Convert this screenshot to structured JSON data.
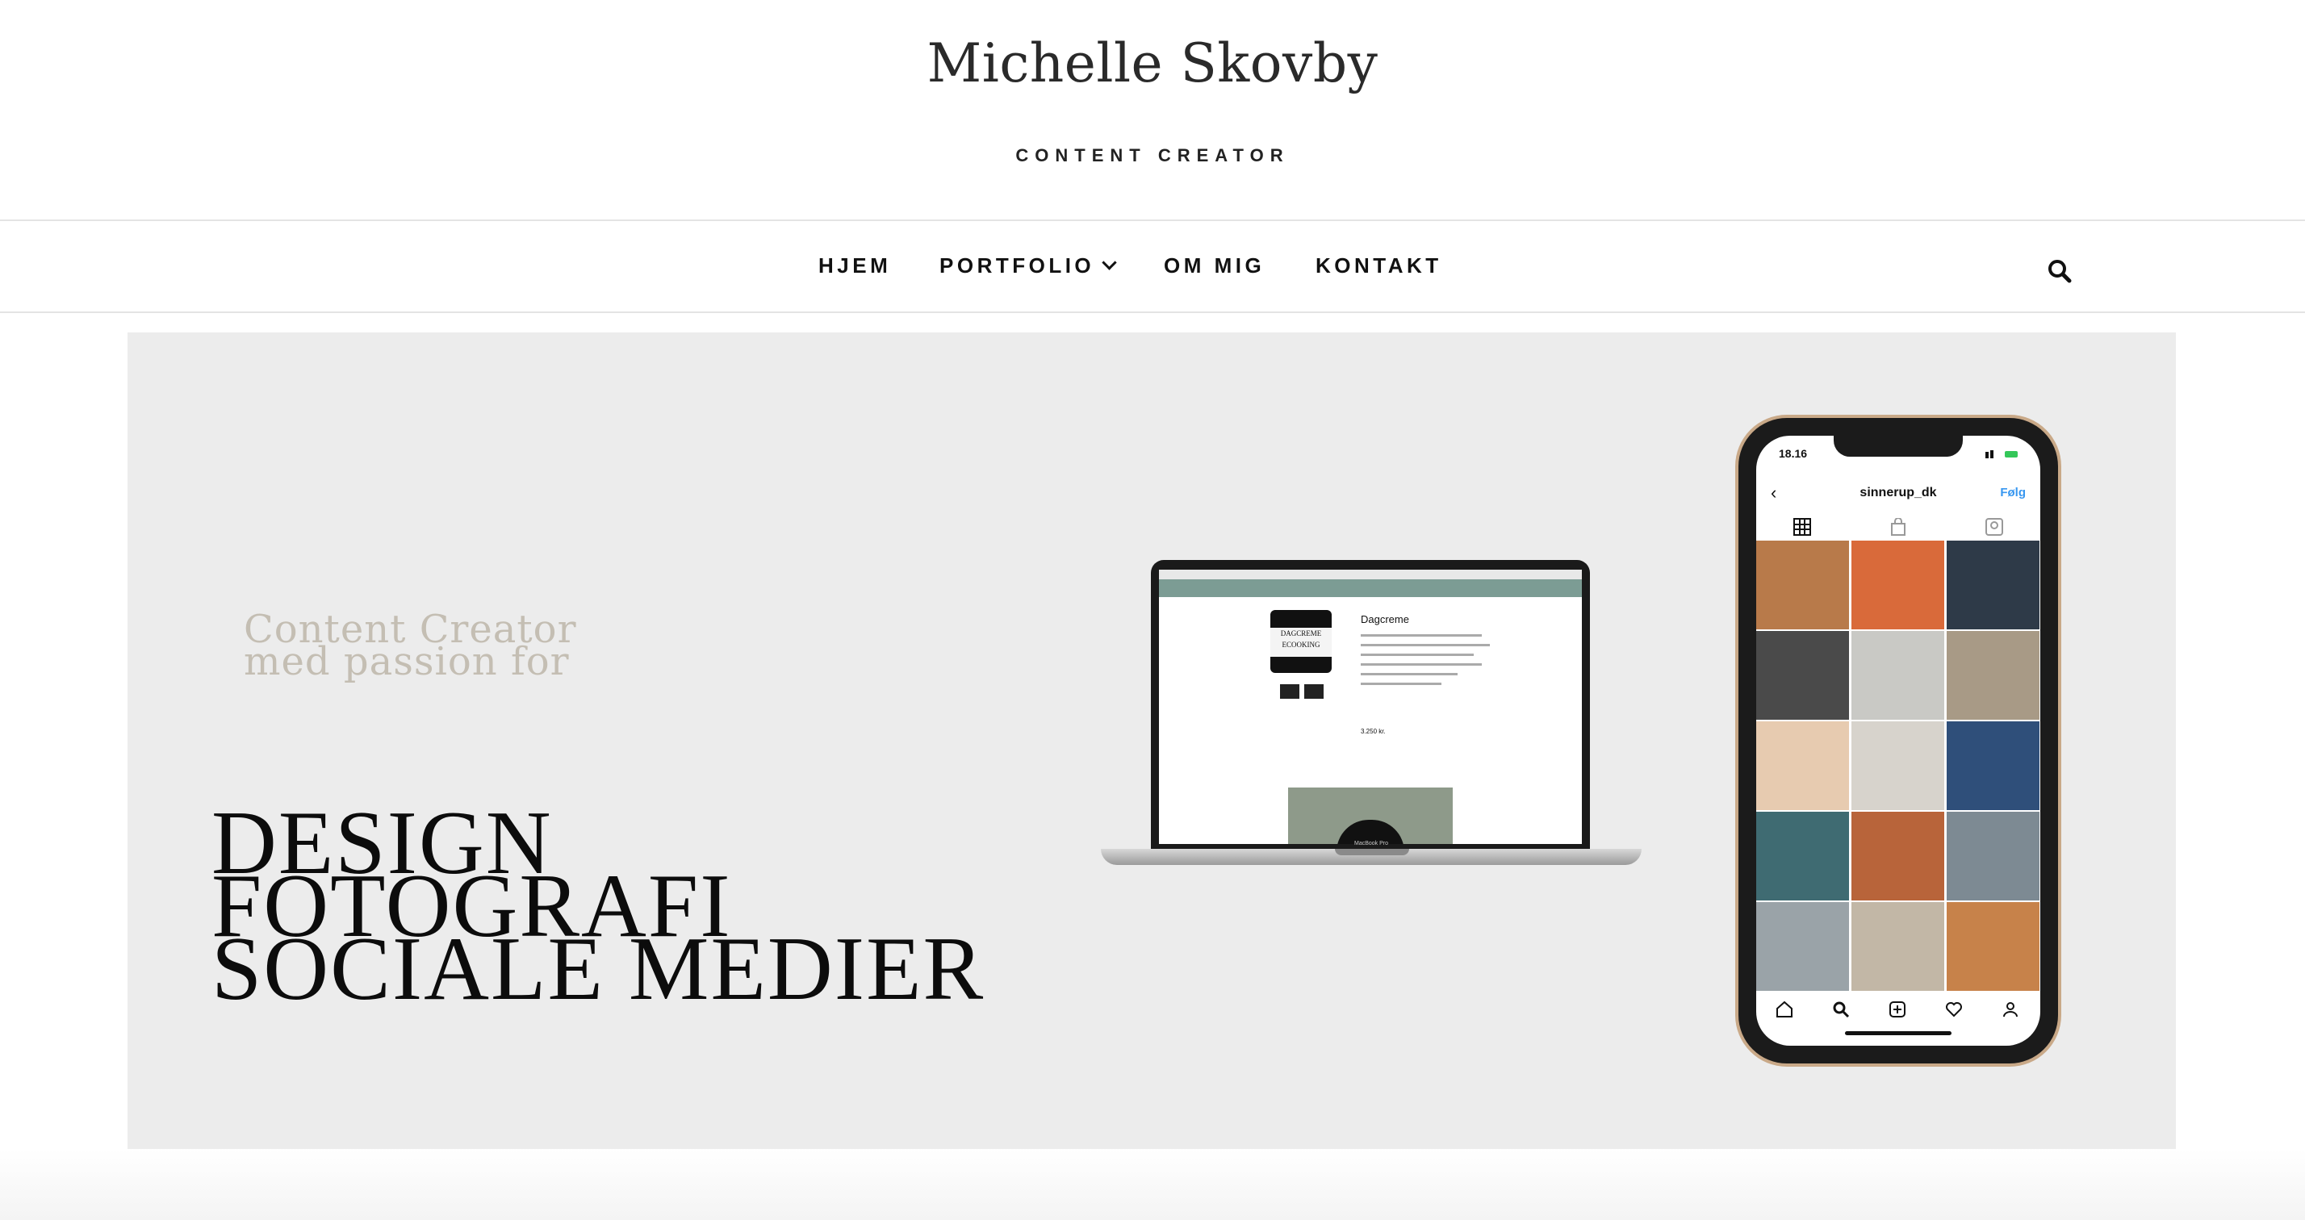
{
  "site": {
    "title": "Michelle Skovby",
    "tagline": "CONTENT CREATOR"
  },
  "nav": {
    "items": [
      {
        "label": "HJEM"
      },
      {
        "label": "PORTFOLIO",
        "has_dropdown": true
      },
      {
        "label": "OM MIG"
      },
      {
        "label": "KONTAKT"
      }
    ],
    "search_icon": "search-icon"
  },
  "hero": {
    "intro_lines": [
      "Content Creator",
      "med passion for"
    ],
    "topics": [
      "DESIGN",
      "FOTOGRAFI",
      "SOCIALE MEDIER"
    ],
    "background_color": "#ececec",
    "laptop": {
      "product_title": "Dagcreme",
      "jar_brand": "DAGCREME",
      "jar_sub": "ECOOKING",
      "price": "3.250 kr.",
      "device_label": "MacBook Pro"
    },
    "phone": {
      "time": "18.16",
      "username": "sinnerup_dk",
      "follow_label": "Følg"
    }
  },
  "colors": {
    "text": "#111111",
    "intro_text": "#c4beb3",
    "instagram_blue": "#3897f0",
    "nav_border": "#e4e4e4"
  }
}
